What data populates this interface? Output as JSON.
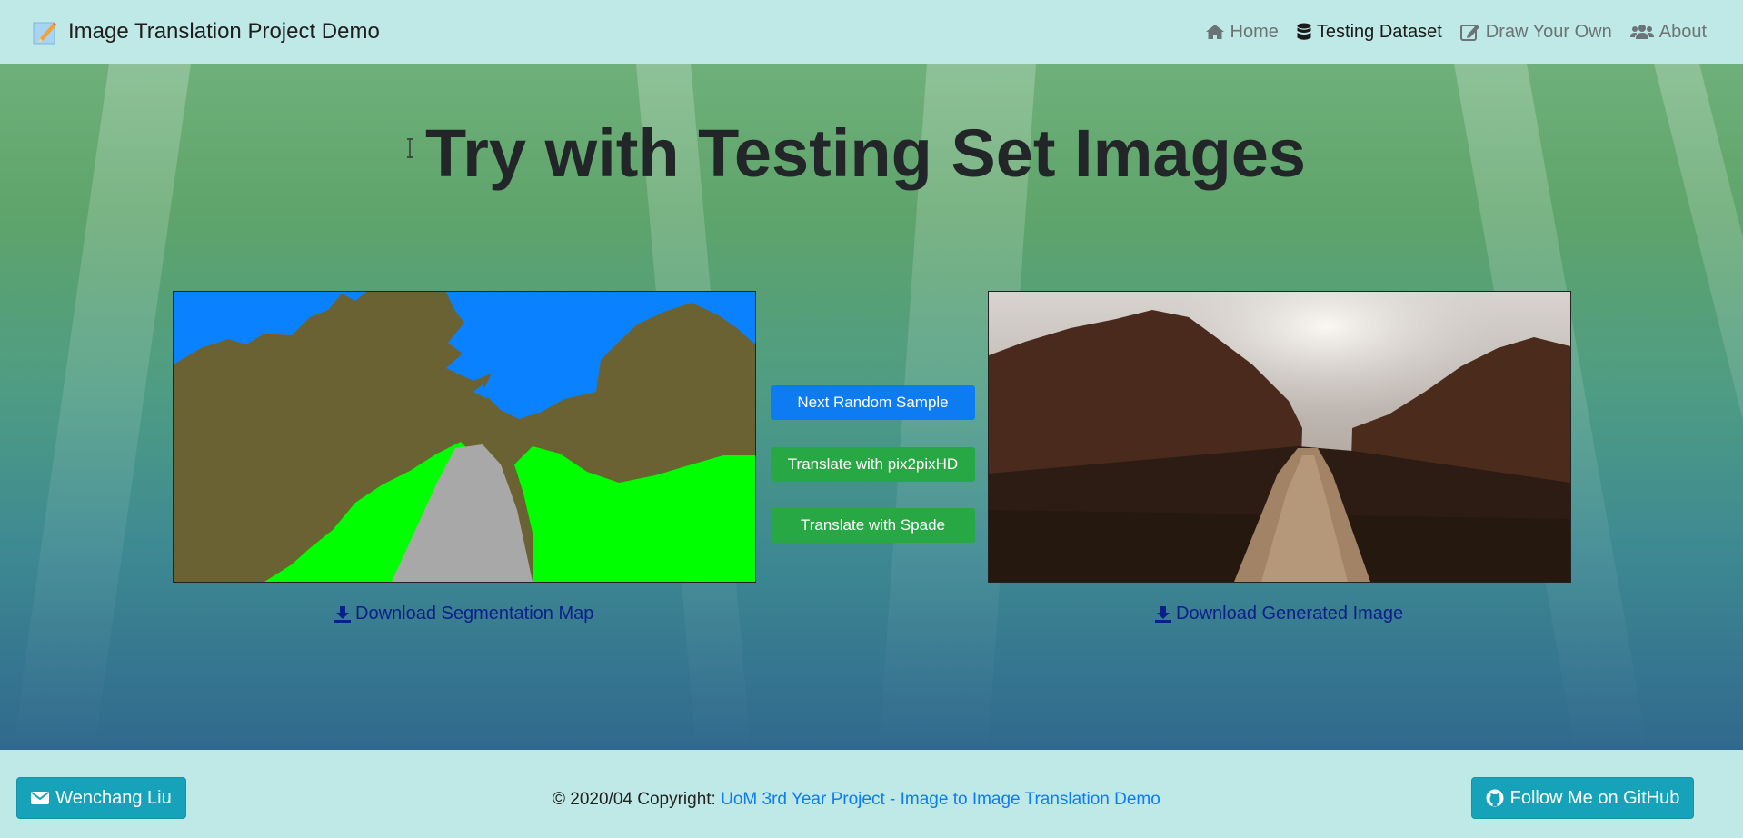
{
  "navbar": {
    "brand": "Image Translation Project Demo",
    "brand_icon": "memo-pencil-icon",
    "items": [
      {
        "label": "Home",
        "icon": "home-icon",
        "active": false
      },
      {
        "label": "Testing Dataset",
        "icon": "database-icon",
        "active": true
      },
      {
        "label": "Draw Your Own",
        "icon": "edit-icon",
        "active": false
      },
      {
        "label": "About",
        "icon": "users-icon",
        "active": false
      }
    ]
  },
  "main": {
    "title": "Try with Testing Set Images",
    "left_image": "segmentation-map",
    "right_image": "generated-image",
    "buttons": {
      "next": "Next Random Sample",
      "pix2pixhd": "Translate with pix2pixHD",
      "spade": "Translate with Spade"
    },
    "download_segmentation": "Download Segmentation Map",
    "download_generated": "Download Generated Image"
  },
  "footer": {
    "author_button": "Wenchang Liu",
    "author_icon": "envelope-icon",
    "copyright_prefix": "© 2020/04 Copyright: ",
    "copyright_link": "UoM 3rd Year Project - Image to Image Translation Demo",
    "github_button": "Follow Me on GitHub",
    "github_icon": "github-icon"
  },
  "colors": {
    "primary": "#0d7cf2",
    "success": "#28a745",
    "info": "#16a2b8",
    "nav_bg": "#bfe9e6",
    "seg_sky": "#0a82ff",
    "seg_tree": "#6b6233",
    "seg_grass": "#00ff00",
    "seg_road": "#a8a8a8"
  }
}
